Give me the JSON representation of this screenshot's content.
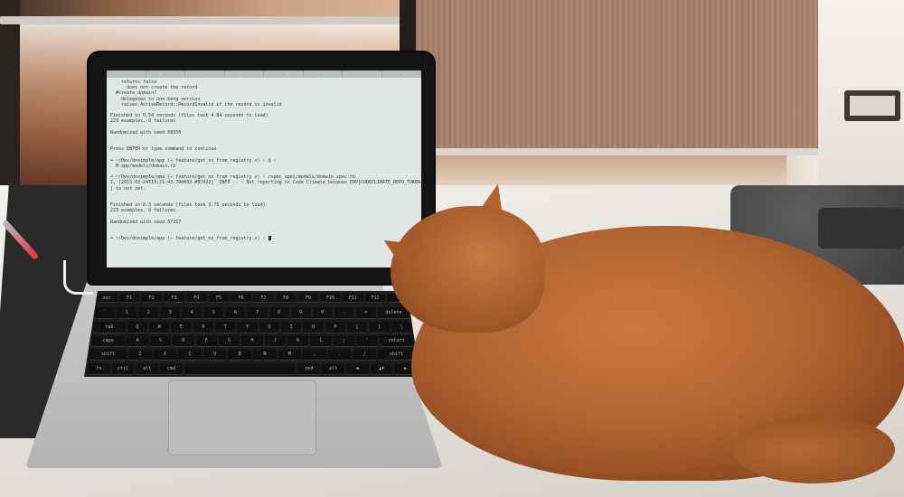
{
  "scene": {
    "description_icons": [
      "cat-icon",
      "laptop-icon"
    ]
  },
  "terminal": {
    "tabs": [
      "…",
      "…",
      "…",
      "…",
      "…",
      "…",
      "…",
      "…"
    ],
    "lines": [
      "    returns false",
      "      does not create the record",
      "  #create_domain?",
      "    delegates to non-bang version",
      "    raises ActiveRecord::RecordInvalid if the record is invalid",
      "",
      "Finished in 0.54 seconds (files took 4.84 seconds to load)",
      "223 examples, 0 failures",
      "",
      "Randomized with seed 56550",
      "",
      "",
      "Press ENTER or type command to continue",
      "",
      "➜ ~/Dev/dnsimple/app (← feature/get_ns_from_registry ✗) ‹ @ ‹",
      "  M app/models/domain.rb",
      "",
      "➜ ~/Dev/dnsimple/app (← feature/get_ns_from_registry ✗) › rspec spec/models/domain_spec.rb",
      "I, [2015-03-24T13:21:43.700033 #97422]  INFO -- : Not reporting to Code Climate because ENV[CODECLIMATE_REPO_TOKEN",
      "] is not set.",
      "",
      "",
      "Finished in 0.3 seconds (files took 3.75 seconds to load)",
      "223 examples, 0 failures",
      "",
      "Randomized with seed 57157",
      "",
      "",
      "➜ ~/Dev/dnsimple/app (← feature/get_ns_from_registry ✗) ‹ "
    ]
  },
  "keyboard": {
    "rows": [
      [
        "esc",
        "F1",
        "F2",
        "F3",
        "F4",
        "F5",
        "F6",
        "F7",
        "F8",
        "F9",
        "F10",
        "F11",
        "F12",
        ""
      ],
      [
        "`",
        "1",
        "2",
        "3",
        "4",
        "5",
        "6",
        "7",
        "8",
        "9",
        "0",
        "-",
        "=",
        "delete"
      ],
      [
        "tab",
        "Q",
        "W",
        "E",
        "R",
        "T",
        "Y",
        "U",
        "I",
        "O",
        "P",
        "[",
        "]",
        "\\"
      ],
      [
        "caps",
        "A",
        "S",
        "D",
        "F",
        "G",
        "H",
        "J",
        "K",
        "L",
        ";",
        "'",
        "return"
      ],
      [
        "shift",
        "Z",
        "X",
        "C",
        "V",
        "B",
        "N",
        "M",
        ",",
        ".",
        "/",
        "shift"
      ],
      [
        "fn",
        "ctrl",
        "alt",
        "cmd",
        "",
        "cmd",
        "alt",
        "◀",
        "▲▼",
        "▶"
      ]
    ]
  }
}
